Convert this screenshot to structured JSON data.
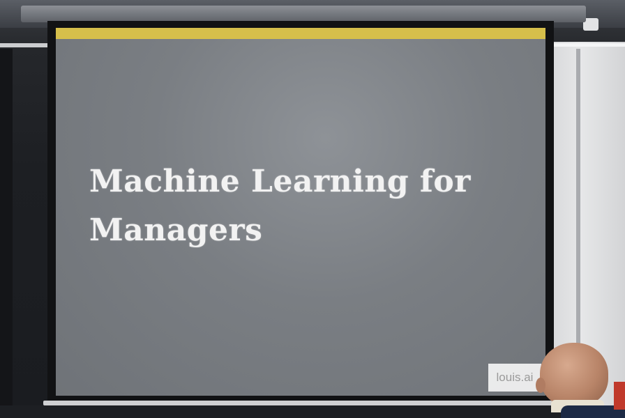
{
  "slide": {
    "title_line1": "Machine Learning for",
    "title_line2": "Managers",
    "watermark": "louis.ai",
    "accent_color": "#d6bf4b",
    "background_color": "#7a7e83"
  }
}
